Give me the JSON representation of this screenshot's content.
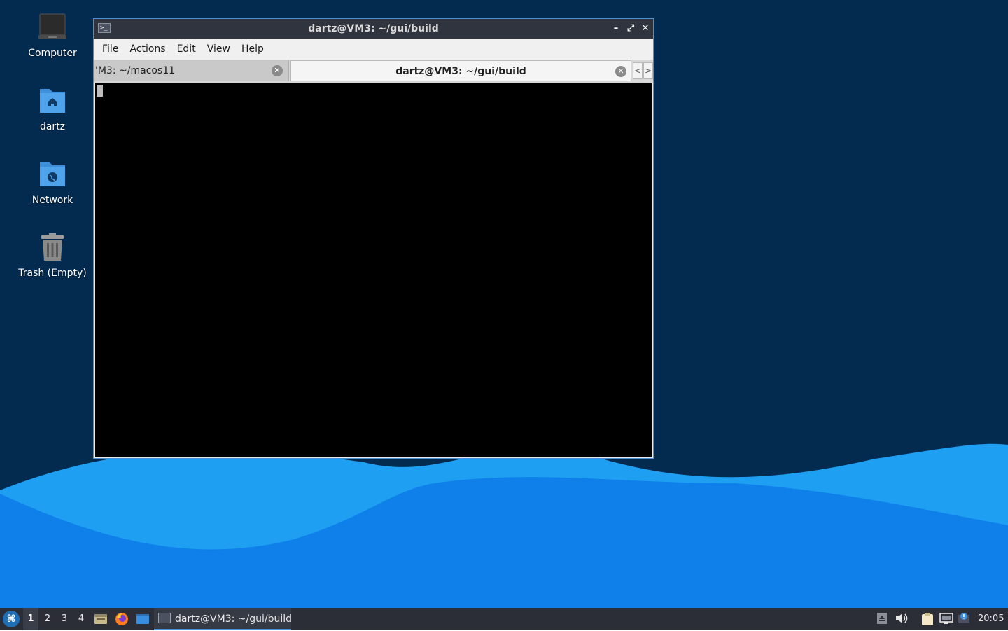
{
  "desktop": {
    "icons": [
      {
        "label": "Computer",
        "icon": "computer-icon"
      },
      {
        "label": "dartz",
        "icon": "home-folder-icon"
      },
      {
        "label": "Network",
        "icon": "network-folder-icon"
      },
      {
        "label": "Trash (Empty)",
        "icon": "trash-icon"
      }
    ],
    "colors": {
      "background": "#032a4f",
      "wave_light": "#1e9ff2",
      "wave_main": "#0f7fea"
    }
  },
  "window": {
    "title": "dartz@VM3: ~/gui/build",
    "app_icon": "terminal-icon",
    "controls": {
      "minimize": "–",
      "maximize": "⤢",
      "close": "✕"
    },
    "menu": [
      "File",
      "Actions",
      "Edit",
      "View",
      "Help"
    ],
    "tabs": [
      {
        "label": "'M3: ~/macos11",
        "active": false
      },
      {
        "label": "dartz@VM3: ~/gui/build",
        "active": true
      }
    ],
    "tab_close_glyph": "✕",
    "scroll_left": "<",
    "scroll_right": ">"
  },
  "taskbar": {
    "start_icon": "start-menu-icon",
    "workspaces": [
      "1",
      "2",
      "3",
      "4"
    ],
    "active_workspace": "1",
    "launchers": [
      "file-manager-icon",
      "firefox-icon",
      "show-desktop-icon"
    ],
    "task": {
      "label": "dartz@VM3: ~/gui/build",
      "icon": "terminal-icon"
    },
    "tray": [
      "removable-media-icon",
      "volume-icon",
      "clipboard-icon",
      "network-icon",
      "notification-icon"
    ],
    "clock": "20:05"
  }
}
